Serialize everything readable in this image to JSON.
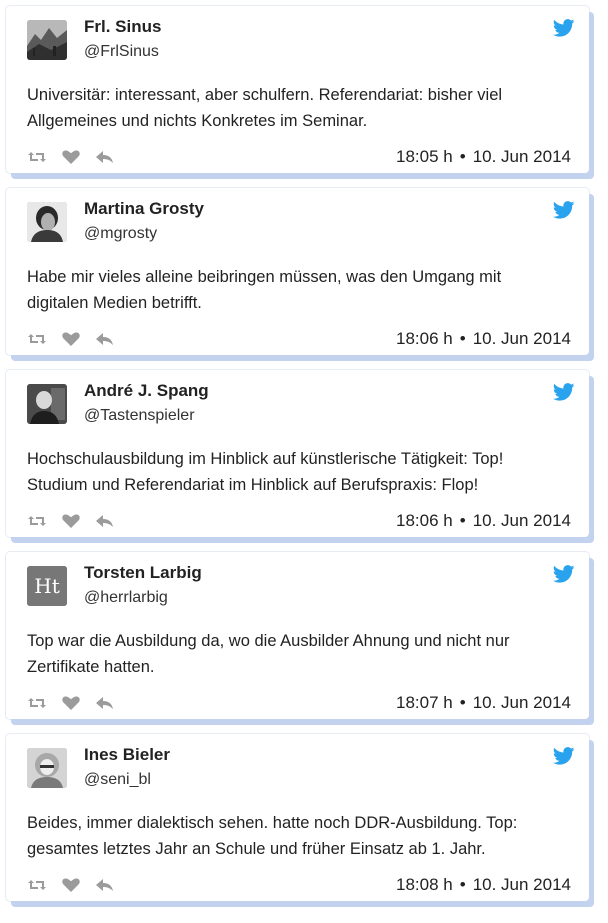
{
  "colors": {
    "bird": "#2aa3ef",
    "shadow": "#c3d3ef",
    "action_icon": "#9b9b9b"
  },
  "tweets": [
    {
      "name": "Frl. Sinus",
      "handle": "@FrlSinus",
      "text_lines": [
        "Universitär: interessant, aber schulfern. Referendariat: bisher viel",
        "Allgemeines und nichts Konkretes im Seminar."
      ],
      "time": "18:05 h",
      "date": "10. Jun 2014",
      "avatar_icon": "landscape-avatar"
    },
    {
      "name": "Martina Grosty",
      "handle": "@mgrosty",
      "text_lines": [
        "Habe mir vieles alleine beibringen müssen, was den Umgang mit",
        "digitalen Medien betrifft."
      ],
      "time": "18:06 h",
      "date": "10. Jun 2014",
      "avatar_icon": "portrait-avatar"
    },
    {
      "name": "André J. Spang",
      "handle": "@Tastenspieler",
      "text_lines": [
        "Hochschulausbildung im Hinblick auf künstlerische Tätigkeit: Top!",
        "Studium und Referendariat im Hinblick auf Berufspraxis: Flop!"
      ],
      "time": "18:06 h",
      "date": "10. Jun 2014",
      "avatar_icon": "portrait-avatar"
    },
    {
      "name": "Torsten Larbig",
      "handle": "@herrlarbig",
      "text_lines": [
        "Top war die Ausbildung da, wo die Ausbilder Ahnung und nicht nur",
        "Zertifikate hatten."
      ],
      "time": "18:07 h",
      "date": "10. Jun 2014",
      "avatar_icon": "monogram-avatar",
      "avatar_text": "Ht"
    },
    {
      "name": "Ines Bieler",
      "handle": "@seni_bl",
      "text_lines": [
        "Beides, immer dialektisch sehen. hatte noch DDR-Ausbildung. Top:",
        "gesamtes letztes Jahr an Schule und früher Einsatz ab 1. Jahr."
      ],
      "time": "18:08 h",
      "date": "10. Jun 2014",
      "avatar_icon": "portrait-avatar"
    }
  ]
}
